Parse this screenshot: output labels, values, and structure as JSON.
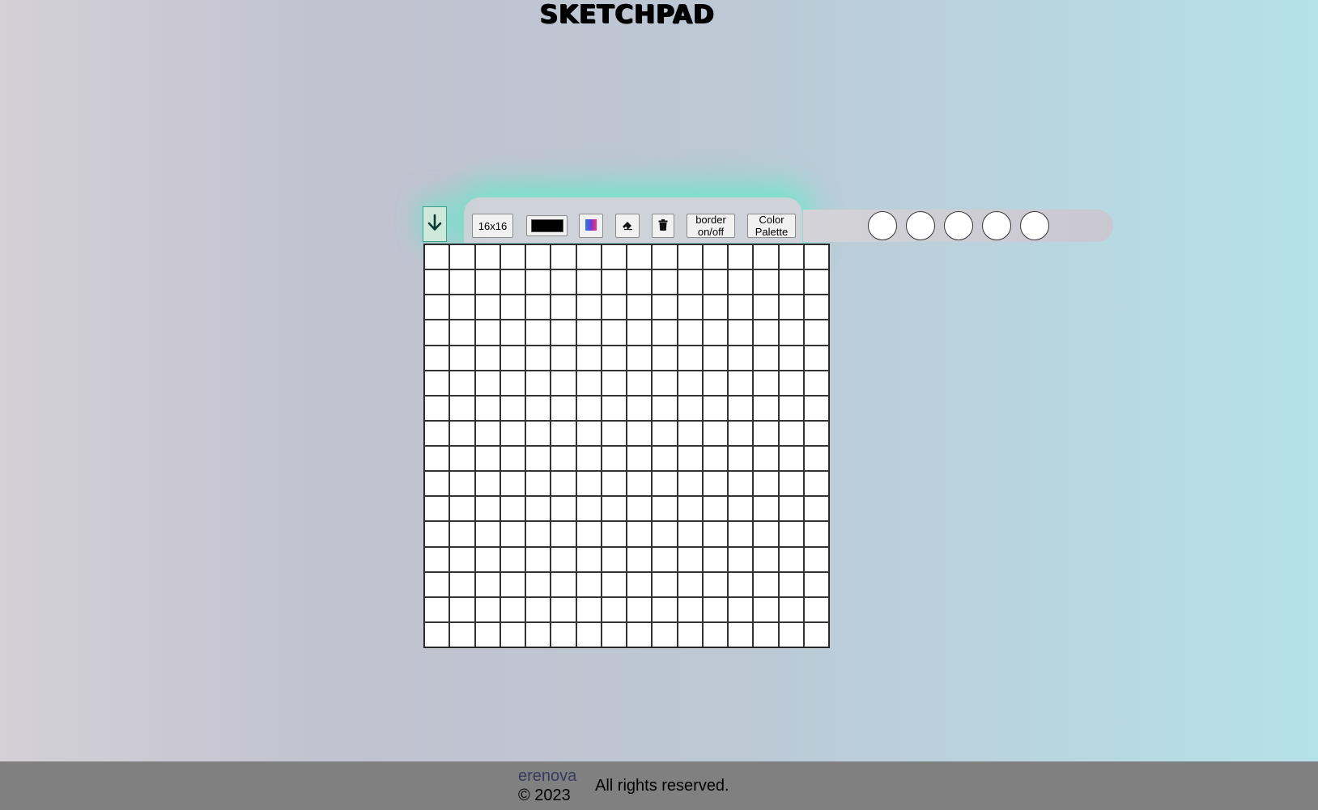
{
  "header": {
    "title": "SKETCHPAD"
  },
  "toolbar": {
    "toggle_icon": "arrow-down-icon",
    "grid_size_label": "16x16",
    "current_color": "#000000",
    "rainbow_icon": "rainbow-gradient-icon",
    "eraser_icon": "eraser-icon",
    "clear_icon": "trash-icon",
    "border_toggle_label_line1": "border",
    "border_toggle_label_line2": "on/off",
    "palette_label_line1": "Color",
    "palette_label_line2": "Palette",
    "glow_color": "#50f0c8"
  },
  "palette": {
    "slots": [
      "#ffffff",
      "#ffffff",
      "#ffffff",
      "#ffffff",
      "#ffffff"
    ]
  },
  "canvas": {
    "rows": 16,
    "columns": 16,
    "cell_color": "#ffffff"
  },
  "footer": {
    "author": "erenova",
    "copyright": "© 2023",
    "rights": "All rights reserved."
  }
}
